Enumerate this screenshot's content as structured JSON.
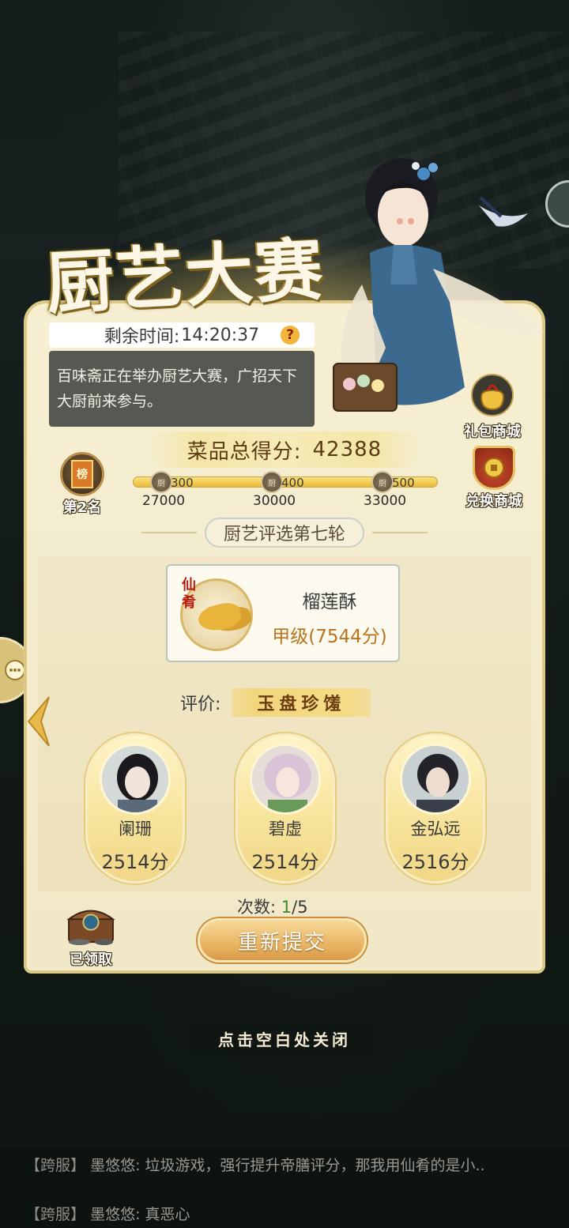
{
  "event": {
    "title": "厨艺大赛",
    "timer_label": "剩余时间:",
    "timer_value": "14:20:37",
    "help_symbol": "?",
    "description": "百味斋正在举办厨艺大赛，广招天下大厨前来参与。"
  },
  "score": {
    "label": "菜品总得分:",
    "value": "42388"
  },
  "rank": {
    "label": "第2名",
    "icon_text": "榜"
  },
  "gift_shop": {
    "label": "礼包商城"
  },
  "exchange_shop": {
    "label": "兑换商城"
  },
  "progress": {
    "milestones": [
      {
        "coin": "厨",
        "reward": "300",
        "threshold": "27000"
      },
      {
        "coin": "厨",
        "reward": "400",
        "threshold": "30000"
      },
      {
        "coin": "厨",
        "reward": "500",
        "threshold": "33000"
      }
    ]
  },
  "round": {
    "title": "厨艺评选第七轮"
  },
  "dish": {
    "tag": "仙肴",
    "name": "榴莲酥",
    "grade": "甲级(7544分)"
  },
  "evaluation": {
    "label": "评价:",
    "value": "玉盘珍馐"
  },
  "judges": [
    {
      "name": "阑珊",
      "score": "2514分"
    },
    {
      "name": "碧虚",
      "score": "2514分"
    },
    {
      "name": "金弘远",
      "score": "2516分"
    }
  ],
  "attempts": {
    "label": "次数:",
    "current": "1",
    "total": "/5"
  },
  "resubmit_label": "重新提交",
  "claim": {
    "label": "已领取"
  },
  "close_hint": "点击空白处关闭",
  "chat": [
    {
      "channel": "【跨服】",
      "text": "墨悠悠: 垃圾游戏，强行提升帝膳评分，那我用仙肴的是小.."
    },
    {
      "channel": "【跨服】",
      "text": "墨悠悠: 真恶心"
    }
  ],
  "colors": {
    "panel_bg": "#f6efd2",
    "accent_gold": "#e9b564",
    "grade_orange": "#b8731c",
    "dish_tag_red": "#b81f14",
    "count_green": "#3c8a2a"
  }
}
